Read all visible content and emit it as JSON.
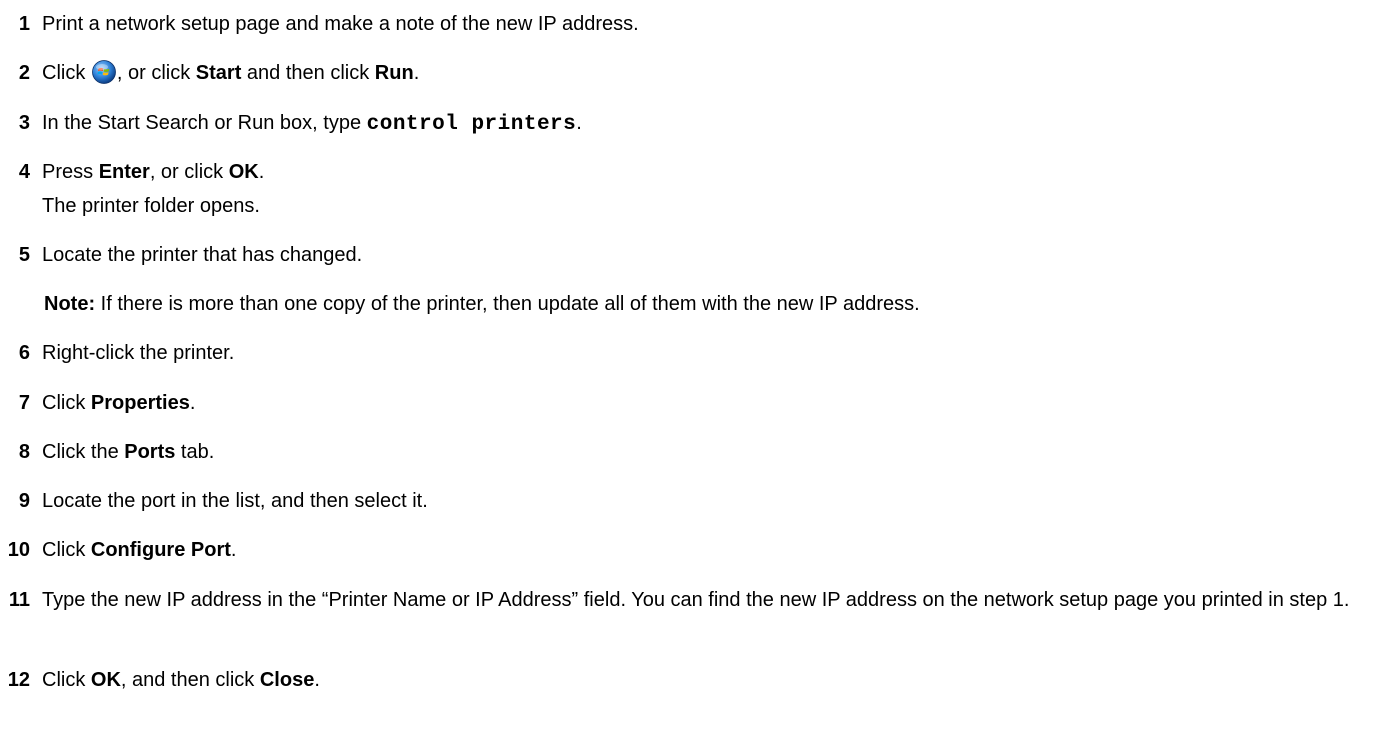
{
  "steps": [
    {
      "n": "1",
      "parts": [
        {
          "t": "Print a network setup page and make a note of the new IP address."
        }
      ]
    },
    {
      "n": "2",
      "parts": [
        {
          "t": "Click "
        },
        {
          "icon": "windows-start-icon"
        },
        {
          "t": ", or click "
        },
        {
          "b": "Start"
        },
        {
          "t": " and then click "
        },
        {
          "b": "Run"
        },
        {
          "t": "."
        }
      ]
    },
    {
      "n": "3",
      "parts": [
        {
          "t": "In the Start Search or Run box, type "
        },
        {
          "code": "control printers"
        },
        {
          "t": "."
        }
      ]
    },
    {
      "n": "4",
      "parts": [
        {
          "t": "Press "
        },
        {
          "b": "Enter"
        },
        {
          "t": ", or click "
        },
        {
          "b": "OK"
        },
        {
          "t": "."
        }
      ],
      "sub": "The printer folder opens."
    },
    {
      "n": "5",
      "parts": [
        {
          "t": "Locate the printer that has changed."
        }
      ]
    },
    {
      "n": "6",
      "parts": [
        {
          "t": "Right-click the printer."
        }
      ]
    },
    {
      "n": "7",
      "parts": [
        {
          "t": "Click "
        },
        {
          "b": "Properties"
        },
        {
          "t": "."
        }
      ]
    },
    {
      "n": "8",
      "parts": [
        {
          "t": "Click the "
        },
        {
          "b": "Ports"
        },
        {
          "t": " tab."
        }
      ]
    },
    {
      "n": "9",
      "parts": [
        {
          "t": "Locate the port in the list, and then select it."
        }
      ]
    },
    {
      "n": "10",
      "parts": [
        {
          "t": "Click "
        },
        {
          "b": "Configure Port"
        },
        {
          "t": "."
        }
      ]
    },
    {
      "n": "11",
      "parts": [
        {
          "t": "Type the new IP address in the “Printer Name or IP Address” field. You can find the new IP address on the network setup page you printed in step 1."
        }
      ]
    },
    {
      "n": "12",
      "parts": [
        {
          "t": "Click "
        },
        {
          "b": "OK"
        },
        {
          "t": ", and then click "
        },
        {
          "b": "Close"
        },
        {
          "t": "."
        }
      ]
    }
  ],
  "note": {
    "label": "Note:",
    "text": " If there is more than one copy of the printer, then update all of them with the new IP address."
  },
  "colors": {
    "text": "#000000",
    "background": "#ffffff",
    "icon_blue": "#1f6fc4"
  }
}
